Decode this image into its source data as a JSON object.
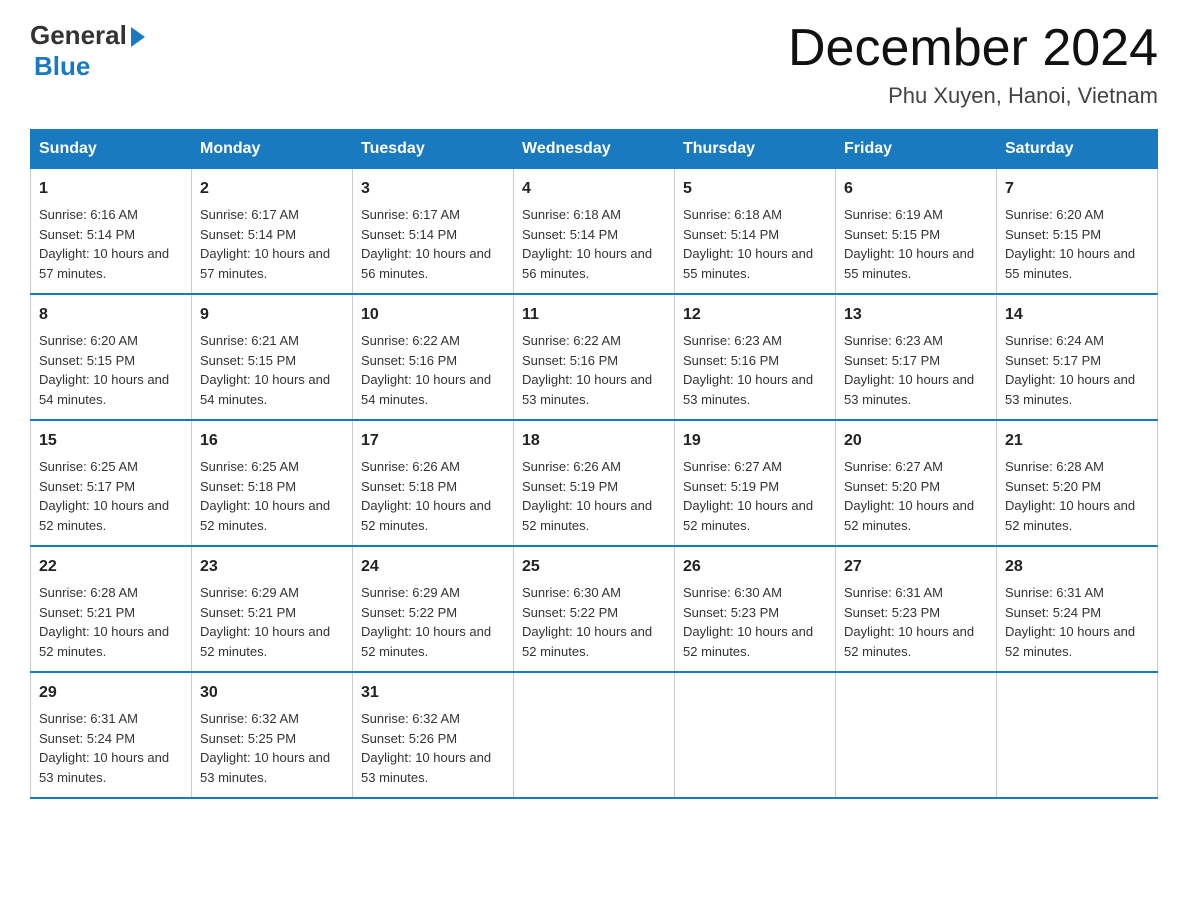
{
  "logo": {
    "general": "General",
    "blue": "Blue"
  },
  "title": "December 2024",
  "subtitle": "Phu Xuyen, Hanoi, Vietnam",
  "days_of_week": [
    "Sunday",
    "Monday",
    "Tuesday",
    "Wednesday",
    "Thursday",
    "Friday",
    "Saturday"
  ],
  "weeks": [
    [
      {
        "day": "1",
        "sunrise": "6:16 AM",
        "sunset": "5:14 PM",
        "daylight": "10 hours and 57 minutes."
      },
      {
        "day": "2",
        "sunrise": "6:17 AM",
        "sunset": "5:14 PM",
        "daylight": "10 hours and 57 minutes."
      },
      {
        "day": "3",
        "sunrise": "6:17 AM",
        "sunset": "5:14 PM",
        "daylight": "10 hours and 56 minutes."
      },
      {
        "day": "4",
        "sunrise": "6:18 AM",
        "sunset": "5:14 PM",
        "daylight": "10 hours and 56 minutes."
      },
      {
        "day": "5",
        "sunrise": "6:18 AM",
        "sunset": "5:14 PM",
        "daylight": "10 hours and 55 minutes."
      },
      {
        "day": "6",
        "sunrise": "6:19 AM",
        "sunset": "5:15 PM",
        "daylight": "10 hours and 55 minutes."
      },
      {
        "day": "7",
        "sunrise": "6:20 AM",
        "sunset": "5:15 PM",
        "daylight": "10 hours and 55 minutes."
      }
    ],
    [
      {
        "day": "8",
        "sunrise": "6:20 AM",
        "sunset": "5:15 PM",
        "daylight": "10 hours and 54 minutes."
      },
      {
        "day": "9",
        "sunrise": "6:21 AM",
        "sunset": "5:15 PM",
        "daylight": "10 hours and 54 minutes."
      },
      {
        "day": "10",
        "sunrise": "6:22 AM",
        "sunset": "5:16 PM",
        "daylight": "10 hours and 54 minutes."
      },
      {
        "day": "11",
        "sunrise": "6:22 AM",
        "sunset": "5:16 PM",
        "daylight": "10 hours and 53 minutes."
      },
      {
        "day": "12",
        "sunrise": "6:23 AM",
        "sunset": "5:16 PM",
        "daylight": "10 hours and 53 minutes."
      },
      {
        "day": "13",
        "sunrise": "6:23 AM",
        "sunset": "5:17 PM",
        "daylight": "10 hours and 53 minutes."
      },
      {
        "day": "14",
        "sunrise": "6:24 AM",
        "sunset": "5:17 PM",
        "daylight": "10 hours and 53 minutes."
      }
    ],
    [
      {
        "day": "15",
        "sunrise": "6:25 AM",
        "sunset": "5:17 PM",
        "daylight": "10 hours and 52 minutes."
      },
      {
        "day": "16",
        "sunrise": "6:25 AM",
        "sunset": "5:18 PM",
        "daylight": "10 hours and 52 minutes."
      },
      {
        "day": "17",
        "sunrise": "6:26 AM",
        "sunset": "5:18 PM",
        "daylight": "10 hours and 52 minutes."
      },
      {
        "day": "18",
        "sunrise": "6:26 AM",
        "sunset": "5:19 PM",
        "daylight": "10 hours and 52 minutes."
      },
      {
        "day": "19",
        "sunrise": "6:27 AM",
        "sunset": "5:19 PM",
        "daylight": "10 hours and 52 minutes."
      },
      {
        "day": "20",
        "sunrise": "6:27 AM",
        "sunset": "5:20 PM",
        "daylight": "10 hours and 52 minutes."
      },
      {
        "day": "21",
        "sunrise": "6:28 AM",
        "sunset": "5:20 PM",
        "daylight": "10 hours and 52 minutes."
      }
    ],
    [
      {
        "day": "22",
        "sunrise": "6:28 AM",
        "sunset": "5:21 PM",
        "daylight": "10 hours and 52 minutes."
      },
      {
        "day": "23",
        "sunrise": "6:29 AM",
        "sunset": "5:21 PM",
        "daylight": "10 hours and 52 minutes."
      },
      {
        "day": "24",
        "sunrise": "6:29 AM",
        "sunset": "5:22 PM",
        "daylight": "10 hours and 52 minutes."
      },
      {
        "day": "25",
        "sunrise": "6:30 AM",
        "sunset": "5:22 PM",
        "daylight": "10 hours and 52 minutes."
      },
      {
        "day": "26",
        "sunrise": "6:30 AM",
        "sunset": "5:23 PM",
        "daylight": "10 hours and 52 minutes."
      },
      {
        "day": "27",
        "sunrise": "6:31 AM",
        "sunset": "5:23 PM",
        "daylight": "10 hours and 52 minutes."
      },
      {
        "day": "28",
        "sunrise": "6:31 AM",
        "sunset": "5:24 PM",
        "daylight": "10 hours and 52 minutes."
      }
    ],
    [
      {
        "day": "29",
        "sunrise": "6:31 AM",
        "sunset": "5:24 PM",
        "daylight": "10 hours and 53 minutes."
      },
      {
        "day": "30",
        "sunrise": "6:32 AM",
        "sunset": "5:25 PM",
        "daylight": "10 hours and 53 minutes."
      },
      {
        "day": "31",
        "sunrise": "6:32 AM",
        "sunset": "5:26 PM",
        "daylight": "10 hours and 53 minutes."
      },
      null,
      null,
      null,
      null
    ]
  ]
}
